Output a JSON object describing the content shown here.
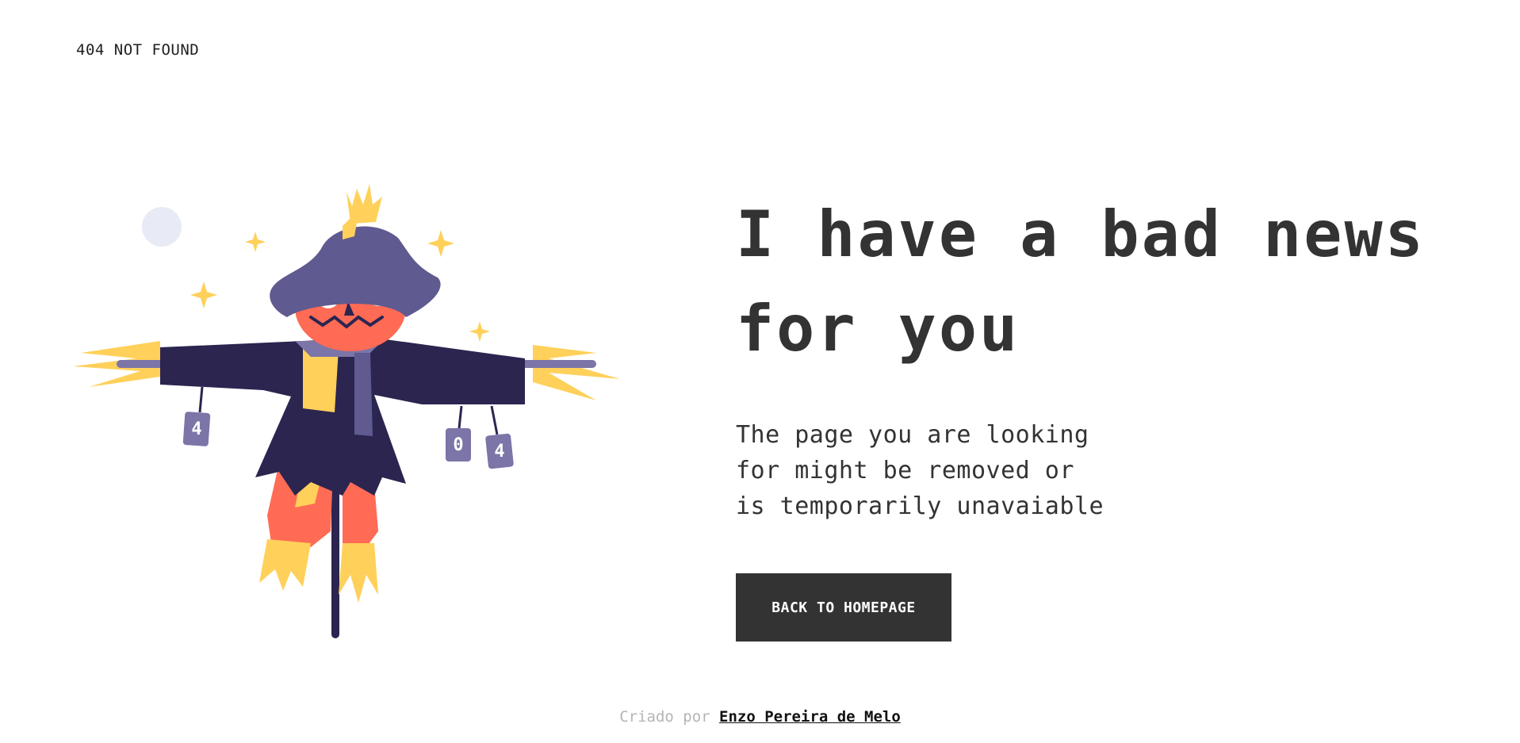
{
  "header": {
    "status_label": "404 NOT FOUND"
  },
  "main": {
    "headline": "I have a bad news\nfor you",
    "description": "The page you are looking\nfor might be removed or\nis temporarily unavaiable",
    "button_label": "BACK TO HOMEPAGE"
  },
  "illustration": {
    "subject": "scarecrow",
    "cans": [
      "4",
      "0",
      "4"
    ]
  },
  "footer": {
    "prefix": "Criado por",
    "author": "Enzo Pereira de Melo"
  },
  "colors": {
    "text": "#333333",
    "button_bg": "#333333",
    "button_text": "#ffffff",
    "hat": "#5f5a8f",
    "coat": "#2b2550",
    "face": "#ff6b55",
    "straw": "#ffd05a",
    "moon": "#e8ebf5"
  }
}
